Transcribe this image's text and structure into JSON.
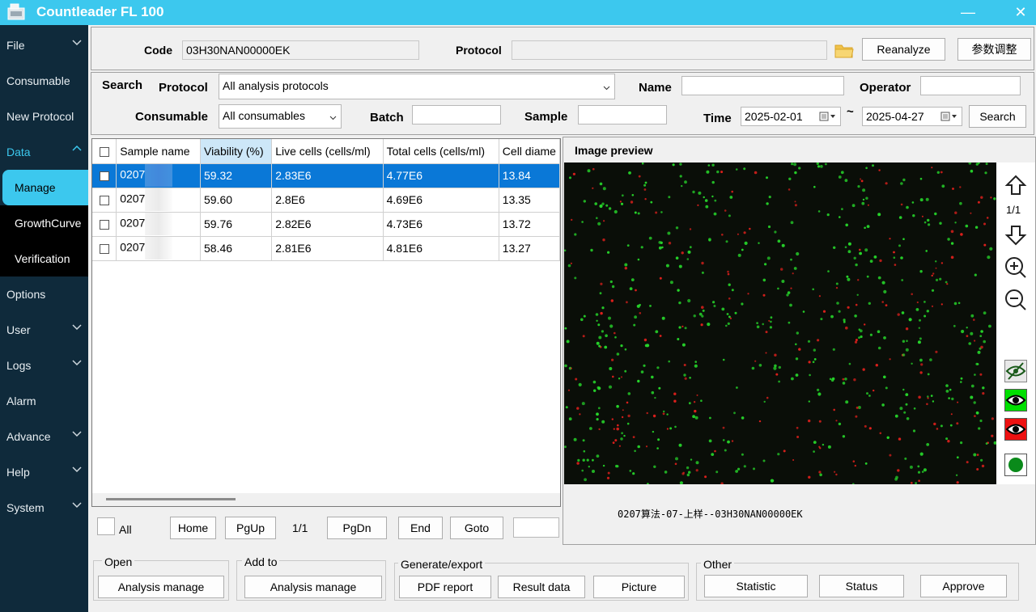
{
  "window": {
    "title": "Countleader FL 100",
    "minimize": "—",
    "close": "✕"
  },
  "sidebar": {
    "items": [
      {
        "label": "File"
      },
      {
        "label": "Consumable"
      },
      {
        "label": "New Protocol"
      },
      {
        "label": "Data"
      },
      {
        "label": "Options"
      },
      {
        "label": "User"
      },
      {
        "label": "Logs"
      },
      {
        "label": "Alarm"
      },
      {
        "label": "Advance"
      },
      {
        "label": "Help"
      },
      {
        "label": "System"
      }
    ],
    "data_sub": [
      {
        "label": "Manage"
      },
      {
        "label": "GrowthCurve"
      },
      {
        "label": "Verification"
      }
    ]
  },
  "top": {
    "code_label": "Code",
    "code_value": "03H30NAN00000EK",
    "protocol_label": "Protocol",
    "protocol_value": "",
    "reanalyze": "Reanalyze",
    "param_adjust": "参数调整"
  },
  "search": {
    "title": "Search",
    "protocol_label": "Protocol",
    "protocol_value": "All analysis protocols",
    "name_label": "Name",
    "name_value": "",
    "operator_label": "Operator",
    "operator_value": "",
    "consumable_label": "Consumable",
    "consumable_value": "All consumables",
    "batch_label": "Batch",
    "batch_value": "",
    "sample_label": "Sample",
    "sample_value": "",
    "time_label": "Time",
    "time_from": "2025-02-01",
    "tilde": "~",
    "time_to": "2025-04-27",
    "search_button": "Search"
  },
  "table": {
    "columns": [
      "Sample name",
      "Viability (%)",
      "Live cells (cells/ml)",
      "Total cells (cells/ml)",
      "Cell diame"
    ],
    "rows": [
      {
        "name": "0207",
        "viability": "59.32",
        "live": "2.83E6",
        "total": "4.77E6",
        "diam": "13.84",
        "selected": true
      },
      {
        "name": "0207",
        "viability": "59.60",
        "live": "2.8E6",
        "total": "4.69E6",
        "diam": "13.35",
        "selected": false
      },
      {
        "name": "0207",
        "viability": "59.76",
        "live": "2.82E6",
        "total": "4.73E6",
        "diam": "13.72",
        "selected": false
      },
      {
        "name": "0207",
        "viability": "58.46",
        "live": "2.81E6",
        "total": "4.81E6",
        "diam": "13.27",
        "selected": false
      }
    ]
  },
  "pager": {
    "all": "All",
    "home": "Home",
    "pgup": "PgUp",
    "page": "1/1",
    "pgdn": "PgDn",
    "end": "End",
    "goto": "Goto",
    "goto_value": ""
  },
  "preview": {
    "title": "Image preview",
    "page": "1/1",
    "caption": "0207算法-07-上样--03H30NAN00000EK"
  },
  "groups": {
    "open": {
      "title": "Open",
      "btn": "Analysis manage"
    },
    "add_to": {
      "title": "Add to",
      "btn": "Analysis manage"
    },
    "generate": {
      "title": "Generate/export",
      "pdf": "PDF report",
      "result": "Result data",
      "picture": "Picture"
    },
    "other": {
      "title": "Other",
      "statistic": "Statistic",
      "status": "Status",
      "approve": "Approve"
    }
  },
  "colors": {
    "titlebar": "#3cc8ee",
    "sidebar": "#0f2a3b",
    "accent": "#3cc8ee",
    "selection": "#0a78d7"
  }
}
